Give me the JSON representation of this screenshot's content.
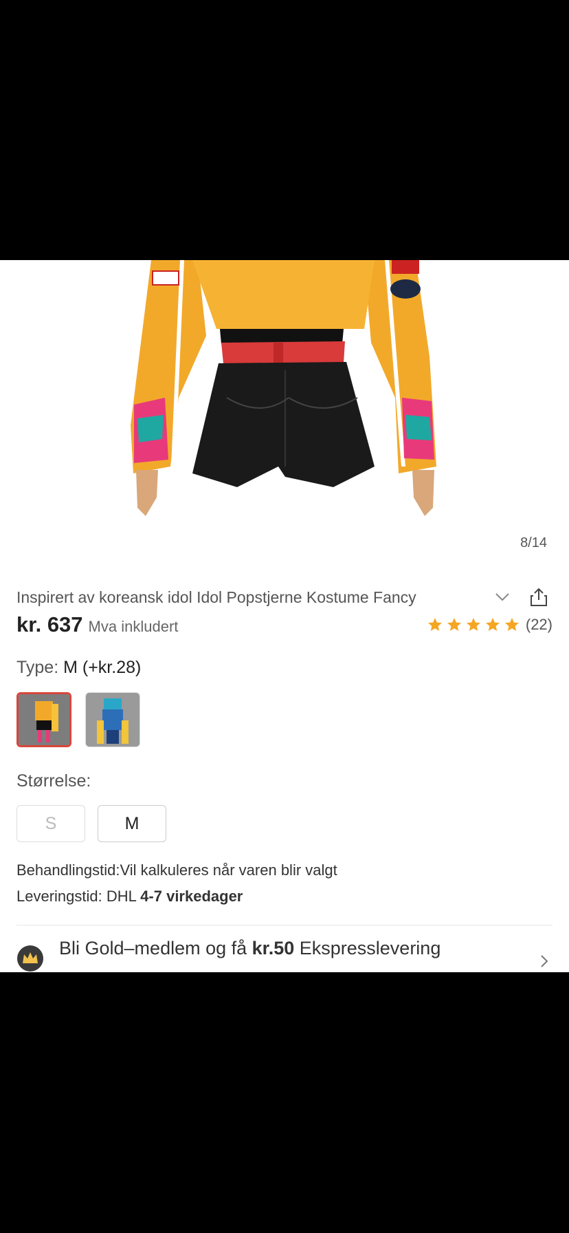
{
  "gallery": {
    "counter": "8/14"
  },
  "product": {
    "title": "Inspirert av koreansk idol Idol Popstjerne Kostume Fancy",
    "price": "kr. 637",
    "tax_note": "Mva inkludert",
    "rating_count": "(22)",
    "rating": 5
  },
  "type_section": {
    "label": "Type:",
    "selected": "M (+kr.28)"
  },
  "size_section": {
    "label": "Størrelse:",
    "options": [
      "S",
      "M"
    ]
  },
  "shipping": {
    "processing": "Behandlingstid:Vil kalkuleres når varen blir valgt",
    "delivery_prefix": "Leveringstid: DHL",
    "delivery_days": "4-7 virkedager"
  },
  "gold": {
    "prefix": "Bli Gold–medlem og få",
    "amount": "kr.50",
    "suffix": "Ekspresslevering"
  },
  "colors": {
    "accent": "#d9463b",
    "star": "#f5a623"
  }
}
